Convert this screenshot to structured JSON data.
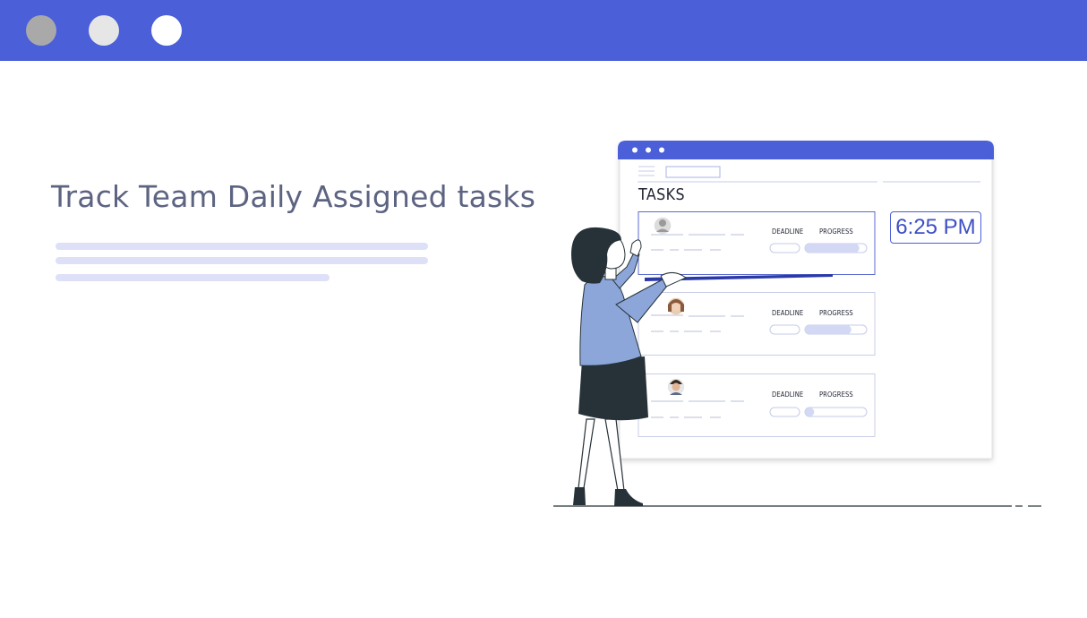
{
  "colors": {
    "accent": "#4a5fd8",
    "headline_text": "#5d6482",
    "placeholder_line": "#dde0f7",
    "progress_fill": "#d3d8f5",
    "dark": "#263238",
    "shirt": "#8ca6d9"
  },
  "window_controls": [
    "window-dot-gray",
    "window-dot-light",
    "window-dot-white"
  ],
  "headline": "Track Team Daily Assigned tasks",
  "illustration": {
    "tasks_title": "TASKS",
    "clock_time": "6:25 PM",
    "task_cards": [
      {
        "deadline_label": "DEADLINE",
        "progress_label": "PROGRESS",
        "progress": 0.88,
        "avatar": "avatar-1"
      },
      {
        "deadline_label": "DEADLINE",
        "progress_label": "PROGRESS",
        "progress": 0.75,
        "avatar": "avatar-2"
      },
      {
        "deadline_label": "DEADLINE",
        "progress_label": "PROGRESS",
        "progress": 0.15,
        "avatar": "avatar-3"
      }
    ]
  }
}
